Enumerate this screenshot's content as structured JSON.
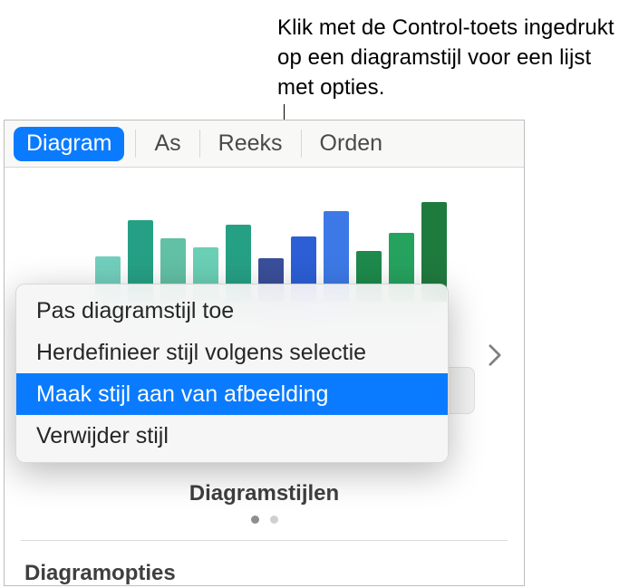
{
  "callout": {
    "text": "Klik met de Control-toets ingedrukt op een diagramstijl voor een lijst met opties."
  },
  "tabs": {
    "diagram": "Diagram",
    "axis": "As",
    "series": "Reeks",
    "arrange": "Orden"
  },
  "menu": {
    "apply": "Pas diagramstijl toe",
    "redefine": "Herdefinieer stijl volgens selectie",
    "create": "Maak stijl aan van afbeelding",
    "delete": "Verwijder stijl"
  },
  "sections": {
    "styles": "Diagramstijlen",
    "options": "Diagramopties"
  },
  "chart_data": {
    "type": "bar",
    "title": "",
    "xlabel": "",
    "ylabel": "",
    "ylim": [
      0,
      120
    ],
    "series": [
      {
        "name": "preview",
        "values": [
          50,
          90,
          70,
          60,
          85,
          48,
          72,
          100,
          56,
          76,
          110
        ]
      }
    ],
    "colors": [
      "#72cfbd",
      "#26a085",
      "#62c0a4",
      "#6acfb5",
      "#26a085",
      "#3a4f9a",
      "#2c5fd6",
      "#3d79e6",
      "#1e8a4c",
      "#26a25f",
      "#1f7a3e"
    ]
  }
}
